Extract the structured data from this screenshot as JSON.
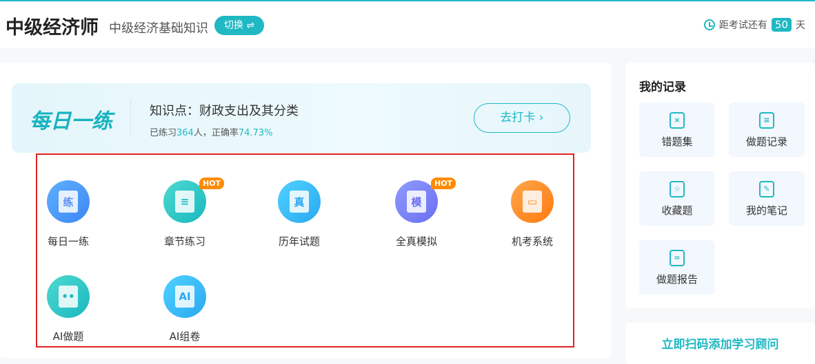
{
  "header": {
    "brand": "中级经济师",
    "subject": "中级经济基础知识",
    "switch_label": "切换 ⇌",
    "countdown_prefix": "距考试还有",
    "countdown_days": "50",
    "countdown_suffix": "天"
  },
  "banner": {
    "logo": "每日一练",
    "knowledge_point": "知识点：财政支出及其分类",
    "stats_prefix": "已练习",
    "practiced": "364",
    "stats_mid": "人，正确率",
    "accuracy": "74.73%",
    "checkin_label": "去打卡 ›"
  },
  "functions": [
    {
      "label": "每日一练",
      "glyph": "练",
      "hot": ""
    },
    {
      "label": "章节练习",
      "glyph": "≡",
      "hot": "HOT"
    },
    {
      "label": "历年试题",
      "glyph": "真",
      "hot": ""
    },
    {
      "label": "全真模拟",
      "glyph": "模",
      "hot": "HOT"
    },
    {
      "label": "机考系统",
      "glyph": "▭",
      "hot": ""
    },
    {
      "label": "AI做题",
      "glyph": "••",
      "hot": ""
    },
    {
      "label": "AI组卷",
      "glyph": "AI",
      "hot": ""
    }
  ],
  "records": {
    "title": "我的记录",
    "items": [
      {
        "label": "错题集",
        "glyph": "×"
      },
      {
        "label": "做题记录",
        "glyph": "≡"
      },
      {
        "label": "收藏题",
        "glyph": "☆"
      },
      {
        "label": "我的笔记",
        "glyph": "✎"
      },
      {
        "label": "做题报告",
        "glyph": "="
      }
    ]
  },
  "advisor": {
    "label": "立即扫码添加学习顾问"
  },
  "colors": {
    "accent": "#1fb8c3",
    "hot": "#ff8a00",
    "highlight_box": "#e02020"
  }
}
